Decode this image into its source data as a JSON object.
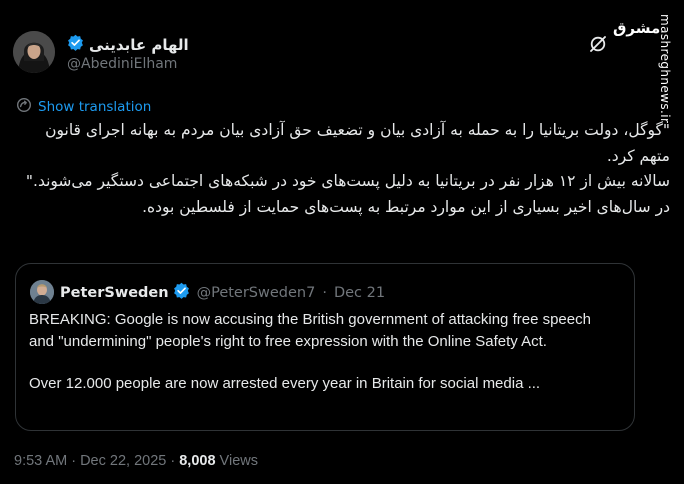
{
  "author": {
    "display_name": "الهام عابدینی",
    "handle": "@AbediniElham",
    "verified": true
  },
  "watermark": {
    "site": "mashreghnews.ir",
    "logo_text": "مشرق"
  },
  "translate_label": "Show translation",
  "tweet_text": "\"گوگل، دولت بریتانیا را به حمله به آزادی بیان و تضعیف حق آزادی بیان مردم به بهانه اجرای قانون متهم کرد.\nسالانه بیش از ۱۲ هزار نفر در بریتانیا به دلیل پست‌های خود در شبکه‌های اجتماعی دستگیر می‌شوند.\"\nدر سال‌های اخیر بسیاری از این موارد مرتبط به پست‌های حمایت از فلسطین بوده.",
  "quote": {
    "display_name": "PeterSweden",
    "handle": "@PeterSweden7",
    "separator": "·",
    "date": "Dec 21",
    "paragraph1": "BREAKING: Google is now accusing the British government of attacking free speech and \"undermining\" people's right to free expression with the Online Safety Act.",
    "paragraph2": "Over 12.000 people are now arrested every year in Britain for social media ..."
  },
  "footer": {
    "timestamp": "9:53 AM · Dec 22, 2025 · ",
    "views_count": "8,008",
    "views_label": " Views"
  },
  "colors": {
    "background": "#000000",
    "text": "#e7e9ea",
    "muted": "#71767b",
    "link": "#1d9bf0",
    "border": "#2f3336"
  },
  "icons": [
    "verified-badge-icon",
    "grok-icon",
    "translate-icon"
  ]
}
